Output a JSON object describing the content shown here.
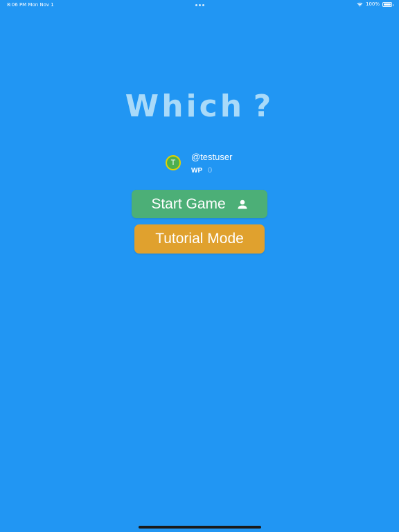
{
  "status_bar": {
    "time_date": "8:06 PM  Mon Nov 1",
    "battery": "100%"
  },
  "app": {
    "title": "Which ?"
  },
  "profile": {
    "avatar_letter": "T",
    "username": "@testuser",
    "wp_label": "WP",
    "wp_value": "0"
  },
  "buttons": {
    "start_game": "Start Game",
    "tutorial_mode": "Tutorial Mode"
  },
  "colors": {
    "background": "#2196F3",
    "title": "#A9DAF9",
    "start_button": "#4CAF77",
    "tutorial_button": "#E0A12E",
    "avatar_fill": "#4CAF50",
    "avatar_ring": "#E3D400"
  },
  "icons": {
    "start_button_icon": "person-icon",
    "status_wifi": "wifi-icon",
    "status_battery": "battery-icon"
  }
}
